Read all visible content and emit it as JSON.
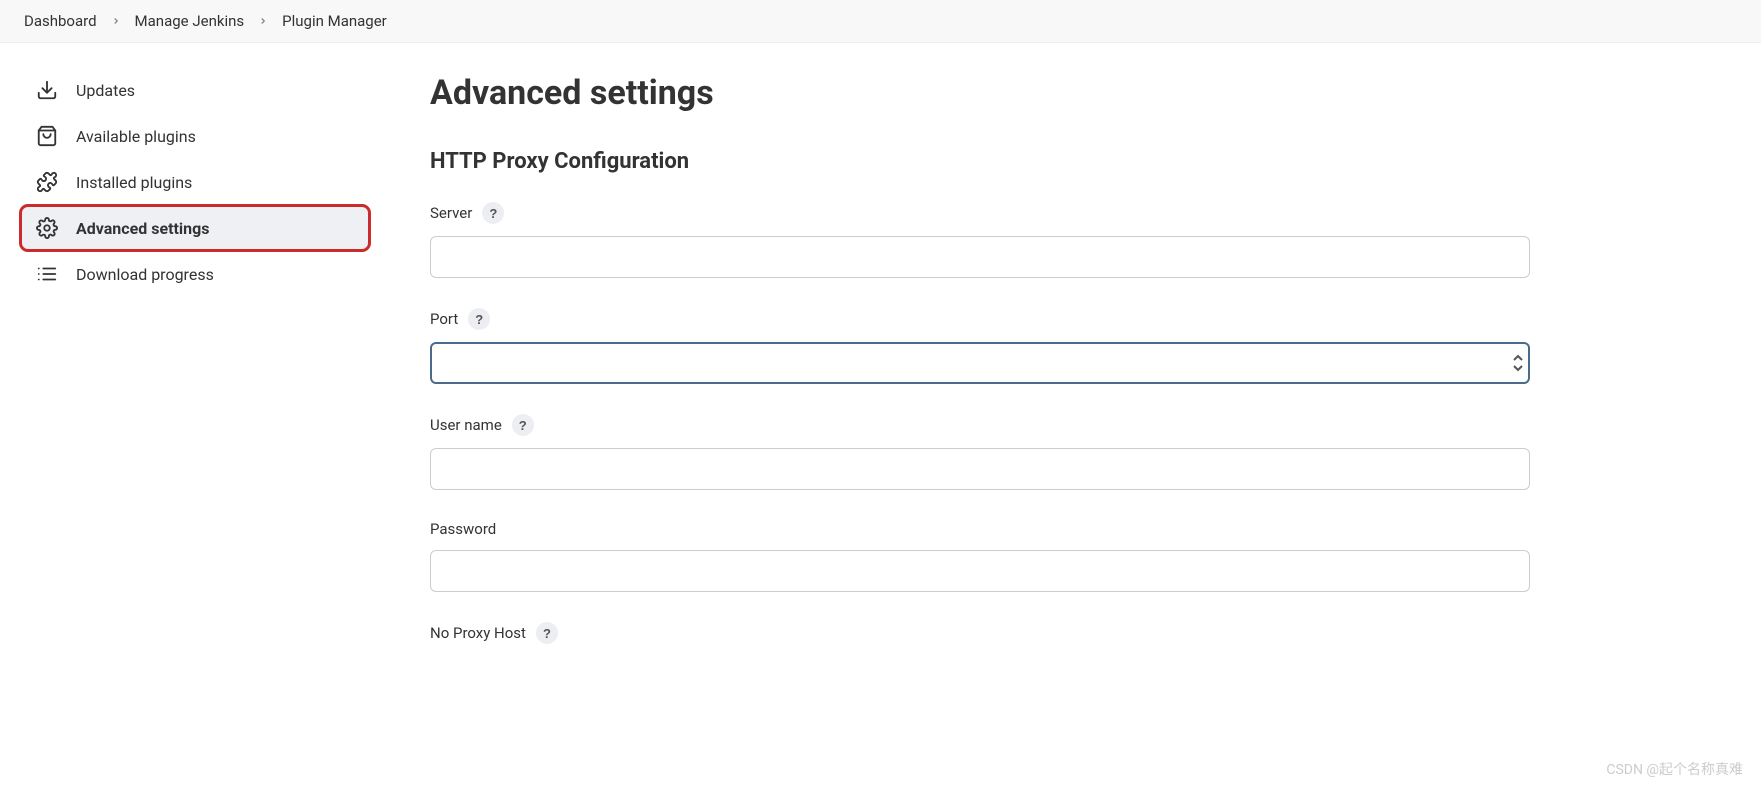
{
  "breadcrumb": {
    "items": [
      {
        "label": "Dashboard"
      },
      {
        "label": "Manage Jenkins"
      },
      {
        "label": "Plugin Manager"
      }
    ]
  },
  "sidebar": {
    "items": [
      {
        "label": "Updates",
        "icon": "download-icon"
      },
      {
        "label": "Available plugins",
        "icon": "shopping-bag-icon"
      },
      {
        "label": "Installed plugins",
        "icon": "puzzle-icon"
      },
      {
        "label": "Advanced settings",
        "icon": "gear-icon",
        "active": true,
        "highlighted": true
      },
      {
        "label": "Download progress",
        "icon": "list-icon"
      }
    ]
  },
  "main": {
    "title": "Advanced settings",
    "section_title": "HTTP Proxy Configuration",
    "fields": {
      "server": {
        "label": "Server",
        "value": "",
        "help": true
      },
      "port": {
        "label": "Port",
        "value": "",
        "help": true,
        "focused": true,
        "numeric": true
      },
      "username": {
        "label": "User name",
        "value": "",
        "help": true
      },
      "password": {
        "label": "Password",
        "value": "",
        "help": false
      },
      "no_proxy_host": {
        "label": "No Proxy Host",
        "value": "",
        "help": true
      }
    }
  },
  "watermark": "CSDN @起个名称真难"
}
